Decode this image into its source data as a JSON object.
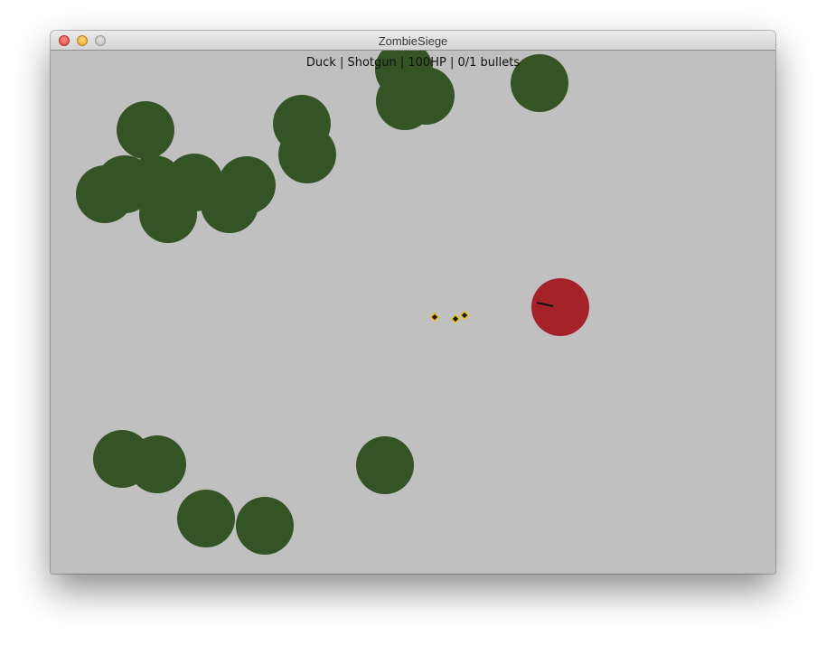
{
  "window": {
    "title": "ZombieSiege"
  },
  "hud": {
    "text": "Duck | Shotgun | 100HP | 0/1 bullets"
  },
  "colors": {
    "background": "#c0c0c0",
    "zombie": "#355425",
    "player": "#a4232a",
    "bullet_fill": "#1a1a1a",
    "bullet_outline": "#e8c21a"
  },
  "entities": {
    "zombie_count": 19,
    "bullet_count": 3,
    "player_weapon_icon": "gun-barrel-line"
  }
}
